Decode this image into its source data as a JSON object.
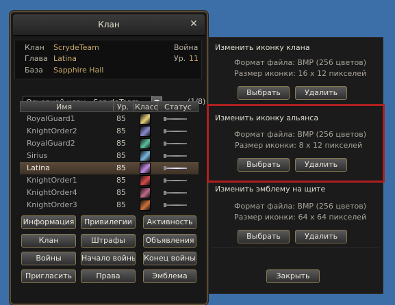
{
  "window": {
    "title": "Клан"
  },
  "clan_info": {
    "clan_label": "Клан",
    "clan_value": "ScrydeTeam",
    "leader_label": "Глава",
    "leader_value": "Latina",
    "base_label": "База",
    "base_value": "Sapphire Hall",
    "war_label": "Война",
    "level_label": "Ур.",
    "level_value": "11"
  },
  "clan_select": {
    "value": "Основной клан - ScrydeTeam",
    "count": "(1/8)"
  },
  "table": {
    "headers": {
      "name": "Имя",
      "level": "Ур.",
      "class": "Класс",
      "status": "Статус"
    },
    "rows": [
      {
        "name": "RoyalGuard1",
        "level": "85",
        "class_color": "#e6d27a"
      },
      {
        "name": "KnightOrder2",
        "level": "85",
        "class_color": "#8a8ad0"
      },
      {
        "name": "RoyalGuard2",
        "level": "85",
        "class_color": "#5cc09a"
      },
      {
        "name": "Sirius",
        "level": "85",
        "class_color": "#79b8e0"
      },
      {
        "name": "Latina",
        "level": "85",
        "class_color": "#c08ae0"
      },
      {
        "name": "KnightOrder1",
        "level": "85",
        "class_color": "#d84a4a"
      },
      {
        "name": "KnightOrder4",
        "level": "85",
        "class_color": "#c06a8a"
      },
      {
        "name": "KnightOrder3",
        "level": "85",
        "class_color": "#d0703a"
      }
    ]
  },
  "buttons": {
    "info": "Информация",
    "privileges": "Привилегии",
    "activity": "Активность",
    "clan": "Клан",
    "penalties": "Штрафы",
    "announcements": "Объявления",
    "wars": "Войны",
    "start_war": "Начало войны",
    "end_war": "Конец войны",
    "invite": "Пригласить",
    "rights": "Права",
    "emblem": "Эмблема"
  },
  "panel": {
    "clan_icon": {
      "title": "Изменить иконку клана",
      "format": "Формат файла: BMP (256 цветов)",
      "size": "Размер иконки: 16 x 12 пикселей",
      "select": "Выбрать",
      "delete": "Удалить"
    },
    "alliance_icon": {
      "title": "Изменить иконку альянса",
      "format": "Формат файла: BMP (256 цветов)",
      "size": "Размер иконки: 8 x 12 пикселей",
      "select": "Выбрать",
      "delete": "Удалить"
    },
    "shield_emblem": {
      "title": "Изменить эмблему на щите",
      "format": "Формат файла: BMP (256 цветов)",
      "size": "Размер иконки: 64 x 64 пикселей",
      "select": "Выбрать",
      "delete": "Удалить"
    },
    "close": "Закрыть"
  }
}
